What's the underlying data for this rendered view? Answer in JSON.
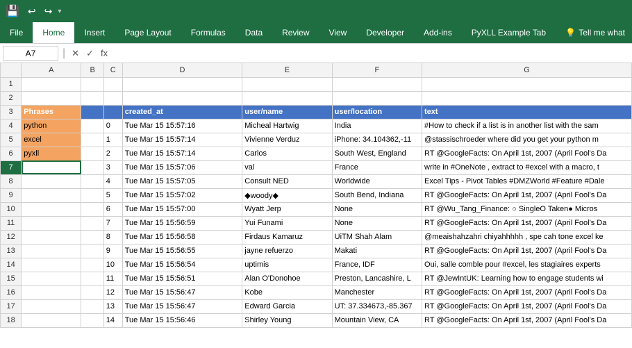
{
  "titlebar": {
    "save_icon": "💾",
    "undo_icon": "↩",
    "redo_icon": "↪",
    "customize_icon": "▾"
  },
  "ribbon": {
    "tabs": [
      "File",
      "Home",
      "Insert",
      "Page Layout",
      "Formulas",
      "Data",
      "Review",
      "View",
      "Developer",
      "Add-ins",
      "PyXLL Example Tab"
    ],
    "tell_me_label": "Tell me what",
    "tell_me_icon": "💡"
  },
  "formulabar": {
    "cell_ref": "A7",
    "cancel_icon": "✕",
    "confirm_icon": "✓",
    "fx_label": "fx"
  },
  "columns": {
    "row_col": "",
    "A": "A",
    "B": "B",
    "C": "C",
    "D": "D",
    "E": "E",
    "F": "F",
    "G": "G"
  },
  "rows": [
    {
      "num": "1",
      "A": "",
      "B": "",
      "C": "",
      "D": "",
      "E": "",
      "F": "",
      "G": ""
    },
    {
      "num": "2",
      "A": "",
      "B": "",
      "C": "",
      "D": "",
      "E": "",
      "F": "",
      "G": ""
    },
    {
      "num": "3",
      "A": "Phrases",
      "B": "",
      "C": "",
      "D": "created_at",
      "E": "user/name",
      "F": "user/location",
      "G": "text",
      "headerRow": true
    },
    {
      "num": "4",
      "A": "python",
      "B": "",
      "C": "0",
      "D": "Tue Mar 15 15:57:16",
      "E": "Micheal Hartwig",
      "F": "India",
      "G": "#How to check if a list is in another list with the sam",
      "orangeA": true
    },
    {
      "num": "5",
      "A": "excel",
      "B": "",
      "C": "1",
      "D": "Tue Mar 15 15:57:14",
      "E": "Vivienne Verduz",
      "F": "iPhone: 34.104362,-11",
      "G": "@stassischroeder where did you get your python m",
      "orangeA": true
    },
    {
      "num": "6",
      "A": "pyxll",
      "B": "",
      "C": "2",
      "D": "Tue Mar 15 15:57:14",
      "E": "Carlos",
      "F": "South West, England",
      "G": "RT @GoogleFacts: On April 1st, 2007 (April Fool's Da",
      "orangeA": true
    },
    {
      "num": "7",
      "A": "",
      "B": "",
      "C": "3",
      "D": "Tue Mar 15 15:57:06",
      "E": "val",
      "F": "France",
      "G": "write in #OneNote , extract to #excel with a macro, t",
      "activeRow": true
    },
    {
      "num": "8",
      "A": "",
      "B": "",
      "C": "4",
      "D": "Tue Mar 15 15:57:05",
      "E": "Consult NED",
      "F": "Worldwide",
      "G": "Excel Tips - Pivot Tables #DMZWorld #Feature #Dale"
    },
    {
      "num": "9",
      "A": "",
      "B": "",
      "C": "5",
      "D": "Tue Mar 15 15:57:02",
      "E": "◆woody◆",
      "F": "South Bend, Indiana",
      "G": "RT @GoogleFacts: On April 1st, 2007 (April Fool's Da"
    },
    {
      "num": "10",
      "A": "",
      "B": "",
      "C": "6",
      "D": "Tue Mar 15 15:57:00",
      "E": "Wyatt Jerp",
      "F": "None",
      "G": "RT @Wu_Tang_Finance: ○ SingleO Taken● Micros"
    },
    {
      "num": "11",
      "A": "",
      "B": "",
      "C": "7",
      "D": "Tue Mar 15 15:56:59",
      "E": "Yui Funami",
      "F": "None",
      "G": "RT @GoogleFacts: On April 1st, 2007 (April Fool's Da"
    },
    {
      "num": "12",
      "A": "",
      "B": "",
      "C": "8",
      "D": "Tue Mar 15 15:56:58",
      "E": "Firdaus Kamaruz",
      "F": "UiTM Shah Alam",
      "G": "@meaishahzahri chiyahhhhh , spe cah tone excel ke"
    },
    {
      "num": "13",
      "A": "",
      "B": "",
      "C": "9",
      "D": "Tue Mar 15 15:56:55",
      "E": "jayne refuerzo",
      "F": "Makati",
      "G": "RT @GoogleFacts: On April 1st, 2007 (April Fool's Da"
    },
    {
      "num": "14",
      "A": "",
      "B": "",
      "C": "10",
      "D": "Tue Mar 15 15:56:54",
      "E": "uptimis",
      "F": "France, IDF",
      "G": "Oui, salle comble pour #excel, les stagiaires experts"
    },
    {
      "num": "15",
      "A": "",
      "B": "",
      "C": "11",
      "D": "Tue Mar 15 15:56:51",
      "E": "Alan O'Donohoe",
      "F": "Preston, Lancashire, L",
      "G": "RT @JewIntUK: Learning how to engage students wi"
    },
    {
      "num": "16",
      "A": "",
      "B": "",
      "C": "12",
      "D": "Tue Mar 15 15:56:47",
      "E": "Kobe",
      "F": "Manchester",
      "G": "RT @GoogleFacts: On April 1st, 2007 (April Fool's Da"
    },
    {
      "num": "17",
      "A": "",
      "B": "",
      "C": "13",
      "D": "Tue Mar 15 15:56:47",
      "E": "Edward Garcia",
      "F": "UT: 37.334673,-85.367",
      "G": "RT @GoogleFacts: On April 1st, 2007 (April Fool's Da"
    },
    {
      "num": "18",
      "A": "",
      "B": "",
      "C": "14",
      "D": "Tue Mar 15 15:56:46",
      "E": "Shirley Young",
      "F": "Mountain View, CA",
      "G": "RT @GoogleFacts: On April 1st, 2007 (April Fool's Da"
    }
  ]
}
